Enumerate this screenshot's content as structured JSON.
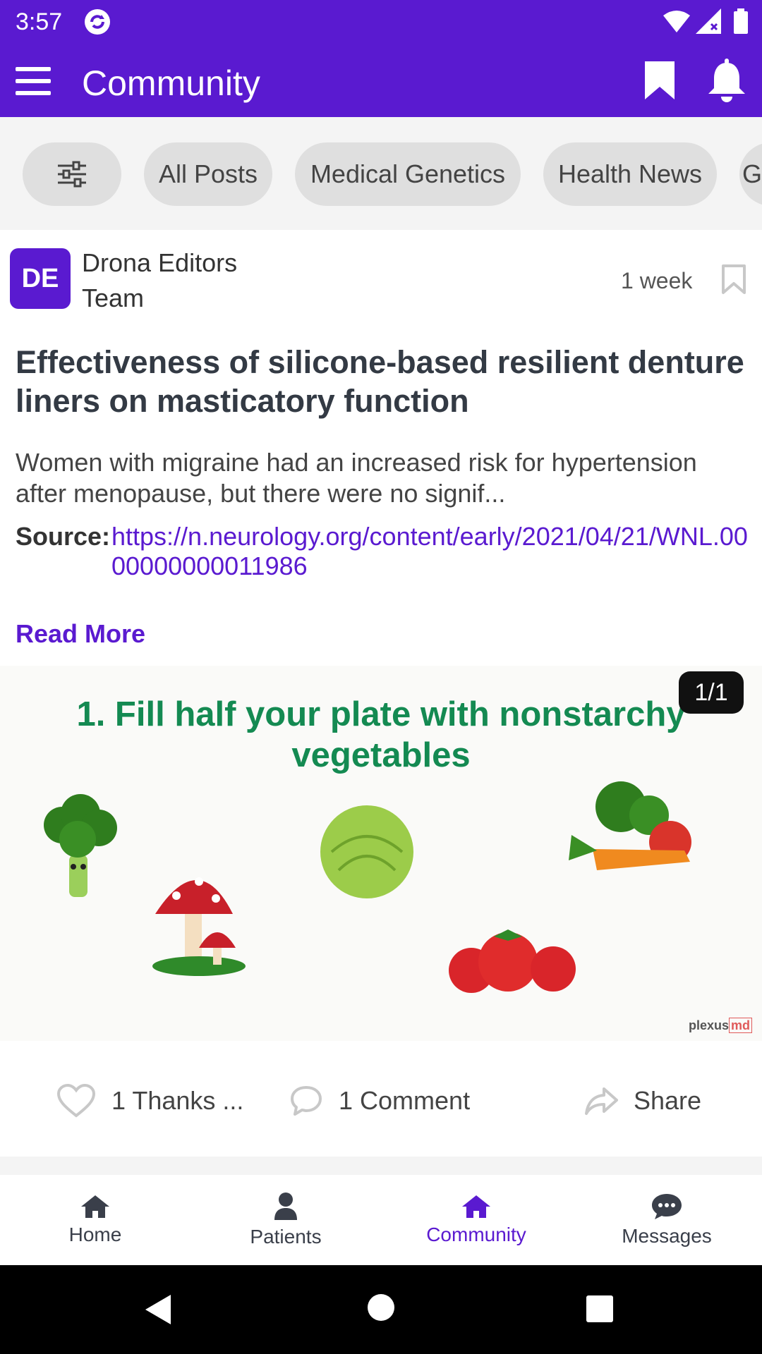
{
  "status_bar": {
    "time": "3:57",
    "icons": [
      "app-sync-icon",
      "wifi-icon",
      "signal-icon",
      "battery-icon"
    ]
  },
  "app_bar": {
    "title": "Community",
    "menu_icon": "hamburger-menu-icon",
    "bookmark_icon": "bookmark-icon",
    "notification_icon": "bell-icon"
  },
  "filters": {
    "filter_icon": "sliders-icon",
    "chips": [
      {
        "label": "All Posts"
      },
      {
        "label": "Medical Genetics"
      },
      {
        "label": "Health News"
      },
      {
        "label": "G"
      }
    ]
  },
  "post": {
    "author": {
      "initials": "DE",
      "name": "Drona Editors Team"
    },
    "time_ago": "1 week",
    "title": "Effectiveness of silicone-based resilient denture liners on masticatory function",
    "excerpt": "Women with migraine had an increased risk for hypertension after menopause, but there were no signif...",
    "source_label": "Source:",
    "source_url": "https://n.neurology.org/content/early/2021/04/21/WNL.0000000000011986",
    "read_more_label": "Read More",
    "image": {
      "heading": "1. Fill half your plate with nonstarchy vegetables",
      "counter": "1/1",
      "watermark_text": "plexus",
      "watermark_badge": "md"
    },
    "actions": {
      "thanks_label": "1 Thanks  ...",
      "comment_label": "1 Comment",
      "share_label": "Share"
    }
  },
  "bottom_nav": {
    "items": [
      {
        "label": "Home",
        "icon": "home-icon"
      },
      {
        "label": "Patients",
        "icon": "person-icon"
      },
      {
        "label": "Community",
        "icon": "community-home-icon",
        "active": true
      },
      {
        "label": "Messages",
        "icon": "chat-bubble-icon"
      }
    ]
  },
  "colors": {
    "brand": "#5a1ad0",
    "chip_bg": "#dfdfdf",
    "image_heading": "#148a52"
  }
}
